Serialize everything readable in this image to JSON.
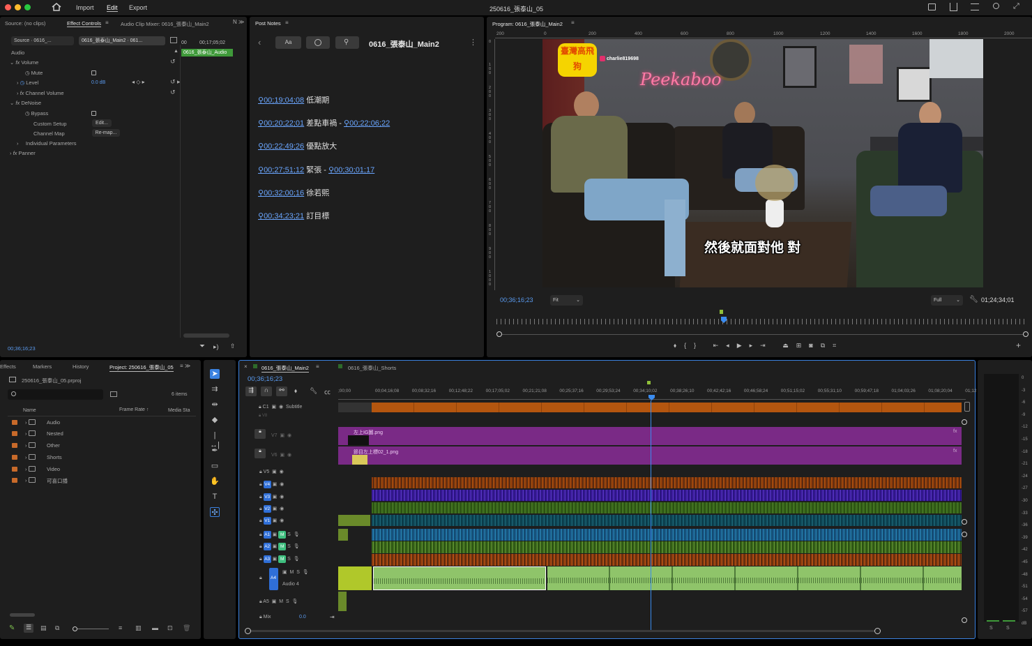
{
  "app": {
    "title": "250616_張泰山_05",
    "menu": [
      "Import",
      "Edit",
      "Export"
    ]
  },
  "colors": {
    "accent": "#3b8cf0",
    "purple": "#7a2a86",
    "orange": "#b45710",
    "green": "#3a7a2a",
    "teal": "#1f6a7a",
    "blue": "#2850b8",
    "audio_green": "#8fc46a"
  },
  "source": {
    "tabs": [
      "Source: (no clips)",
      "Effect Controls",
      "Audio Clip Mixer: 0616_張泰山_Main2"
    ],
    "chip1": "Source · 0616_...",
    "chip2": "0616_張泰山_Main2 · 061...",
    "mini_time": "00;17;05;02",
    "mini_clip": "0616_張泰山_Audio",
    "section": "Audio",
    "rows": [
      {
        "name": "Volume"
      },
      {
        "name": "Mute"
      },
      {
        "name": "Level",
        "value": "0.0 dB"
      },
      {
        "name": "Channel Volume"
      },
      {
        "name": "DeNoise"
      },
      {
        "name": "Bypass"
      },
      {
        "name": "Custom Setup",
        "button": "Edit..."
      },
      {
        "name": "Channel Map",
        "button": "Re-map..."
      },
      {
        "name": "Individual Parameters"
      },
      {
        "name": "Panner"
      }
    ],
    "timecode": "00;36;16;23"
  },
  "notes": {
    "tab": "Post Notes",
    "title": "0616_張泰山_Main2",
    "font_btn": "Aa",
    "items": [
      {
        "tc": "00;19;04;08",
        "text": "低潮期",
        "tc2": "",
        "text2": ""
      },
      {
        "tc": "00;20;22;01",
        "text": "差點車禍 -",
        "tc2": "00;22;06;22",
        "text2": ""
      },
      {
        "tc": "00;22;49;26",
        "text": "優點放大",
        "tc2": "",
        "text2": ""
      },
      {
        "tc": "00;27;51;12",
        "text": "緊張 -",
        "tc2": "00;30;01;17",
        "text2": ""
      },
      {
        "tc": "00;32;00;16",
        "text": "徐若熙",
        "tc2": "",
        "text2": ""
      },
      {
        "tc": "00;34;23;21",
        "text": "訂目標",
        "tc2": "",
        "text2": ""
      }
    ]
  },
  "program": {
    "tab": "Program: 0616_張泰山_Main2",
    "ruler": [
      "200",
      "0",
      "200",
      "400",
      "600",
      "800",
      "1000",
      "1200",
      "1400",
      "1600",
      "1800",
      "2000"
    ],
    "vruler": [
      "0",
      "1\n0\n0",
      "2\n0\n0",
      "3\n0\n0",
      "4\n0\n0",
      "5\n0\n0",
      "6\n0\n0",
      "7\n0\n0",
      "8\n0\n0",
      "9\n0\n0",
      "1\n0\n0\n0"
    ],
    "timecode": "00;36;16;23",
    "fit": "Fit",
    "full": "Full",
    "duration": "01;24;34;01",
    "overlay": {
      "logo": "臺灣高飛狗",
      "insta": "charlie819698",
      "neon": "Peekaboo",
      "subtitle": "然後就面對他 對"
    }
  },
  "project": {
    "tabs": [
      "Effects",
      "Markers",
      "History",
      "Project: 250616_張泰山_05"
    ],
    "file": "250616_張泰山_05.prproj",
    "count": "6 items",
    "cols": [
      "Name",
      "Frame Rate",
      "Media Sta"
    ],
    "items": [
      "Audio",
      "Nested",
      "Other",
      "Shorts",
      "Video",
      "可喜口播"
    ]
  },
  "timeline": {
    "tabs": [
      "0616_張泰山_Main2",
      "0616_張泰山_Shorts"
    ],
    "timecode": "00;36;16;23",
    "ruler": [
      ";00;00",
      "00;04;16;08",
      "00;08;32;16",
      "00;12;48;22",
      "00;17;05;02",
      "00;21;21;08",
      "00;25;37;16",
      "00;29;53;24",
      "00;34;10;02",
      "00;38;26;10",
      "00;42;42;16",
      "00;46;58;24",
      "00;51;15;02",
      "00;55;31;10",
      "00;59;47;18",
      "01;04;03;26",
      "01;08;20;04",
      "01;12"
    ],
    "tracks": [
      {
        "id": "C1",
        "label": "Subtitle"
      },
      {
        "id": "V8"
      },
      {
        "id": "V7"
      },
      {
        "id": "V6"
      },
      {
        "id": "V5"
      },
      {
        "id": "V4"
      },
      {
        "id": "V3"
      },
      {
        "id": "V2"
      },
      {
        "id": "V1"
      },
      {
        "id": "A1",
        "m": "M",
        "s": "S"
      },
      {
        "id": "A2",
        "m": "M",
        "s": "S"
      },
      {
        "id": "A3",
        "m": "M",
        "s": "S"
      },
      {
        "id": "A4",
        "m": "M",
        "s": "S",
        "name": "Audio 4"
      },
      {
        "id": "A5",
        "m": "M",
        "s": "S"
      },
      {
        "id": "Mix",
        "value": "0.0"
      }
    ],
    "clip_v7": "左上IG圖.png",
    "clip_v6": "節目左上標02_1.png",
    "fx": "fx"
  },
  "meter": {
    "scale": [
      "0",
      "-3",
      "-6",
      "-9",
      "-12",
      "-15",
      "-18",
      "-21",
      "-24",
      "-27",
      "-30",
      "-33",
      "-36",
      "-39",
      "-42",
      "-45",
      "-48",
      "-51",
      "-54",
      "-57",
      "dB"
    ],
    "solo": [
      "S",
      "S"
    ]
  }
}
